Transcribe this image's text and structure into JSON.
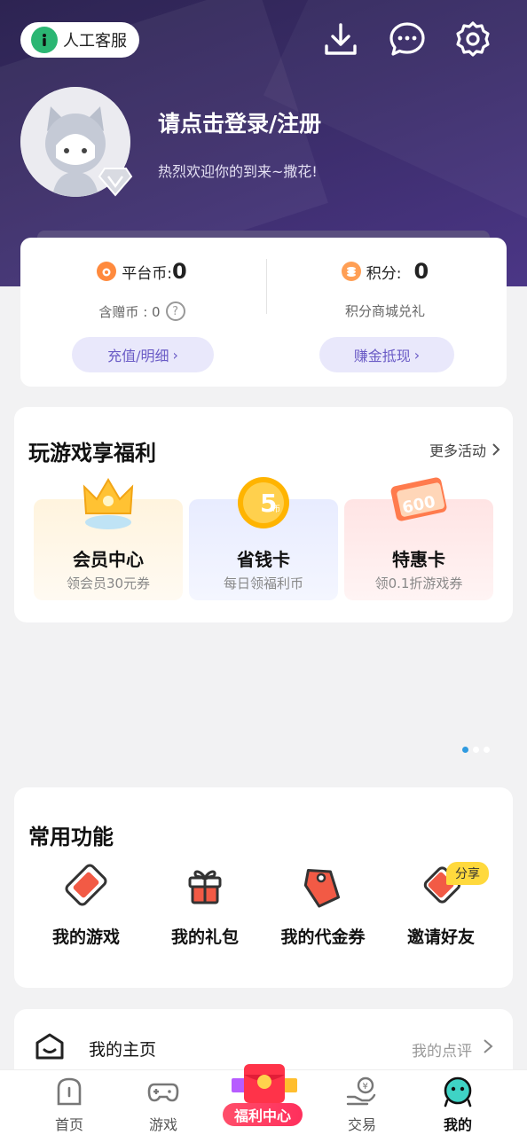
{
  "header": {
    "customer_service": "人工客服",
    "icons": [
      "download-icon",
      "message-icon",
      "settings-icon"
    ],
    "login_title": "请点击登录/注册",
    "welcome_text": "热烈欢迎你的到来~撒花!"
  },
  "stats": {
    "platform_coin_label": "平台币:",
    "platform_coin_value": "0",
    "gift_coin_label": "含赠币 : 0",
    "recharge_button": "充值/明细",
    "points_label": "积分:",
    "points_value": "0",
    "points_mall": "积分商城兑礼",
    "earn_button": "赚金抵现"
  },
  "welfare": {
    "title": "玩游戏享福利",
    "more": "更多活动",
    "items": [
      {
        "title": "会员中心",
        "subtitle": "领会员30元券"
      },
      {
        "title": "省钱卡",
        "subtitle": "每日领福利币",
        "badge": "5"
      },
      {
        "title": "特惠卡",
        "subtitle": "领0.1折游戏券",
        "badge": "600"
      }
    ]
  },
  "common": {
    "title": "常用功能",
    "share_tag": "分享",
    "items": [
      {
        "label": "我的游戏"
      },
      {
        "label": "我的礼包"
      },
      {
        "label": "我的代金券"
      },
      {
        "label": "邀请好友"
      }
    ]
  },
  "profile": {
    "label": "我的主页",
    "review": "我的点评"
  },
  "tabbar": {
    "home": "首页",
    "games": "游戏",
    "welfare_center": "福利中心",
    "trade": "交易",
    "mine": "我的"
  },
  "colors": {
    "hero": "#3a2c68",
    "accent": "#6a5bc6",
    "welfare_red": "#ff2f5c",
    "pagination_active": "#2f9be0"
  }
}
